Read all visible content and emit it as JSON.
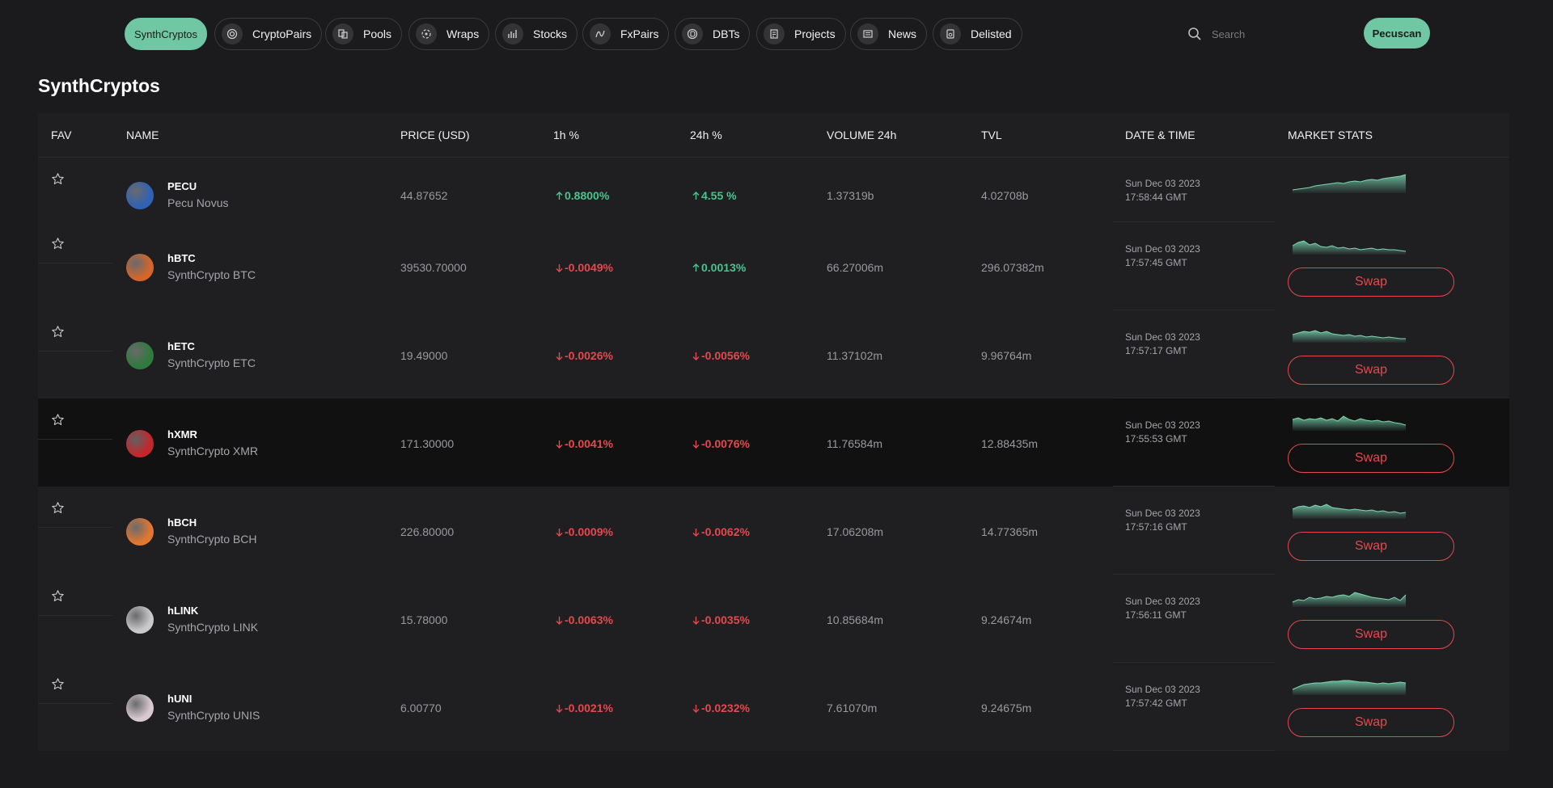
{
  "nav": {
    "tabs": [
      {
        "label": "SynthCryptos",
        "icon": "synthcryptos-icon",
        "active": true
      },
      {
        "label": "CryptoPairs",
        "icon": "coins-icon"
      },
      {
        "label": "Pools",
        "icon": "pools-icon"
      },
      {
        "label": "Wraps",
        "icon": "wraps-icon"
      },
      {
        "label": "Stocks",
        "icon": "stocks-chart-icon"
      },
      {
        "label": "FxPairs",
        "icon": "fxpairs-icon"
      },
      {
        "label": "DBTs",
        "icon": "dbts-icon"
      },
      {
        "label": "Projects",
        "icon": "projects-icon"
      },
      {
        "label": "News",
        "icon": "news-icon"
      },
      {
        "label": "Delisted",
        "icon": "delisted-icon"
      }
    ],
    "search_placeholder": "Search",
    "brand_button": "Pecuscan"
  },
  "page_title": "SynthCryptos",
  "table": {
    "headers": {
      "fav": "FAV",
      "name": "NAME",
      "price": "PRICE (USD)",
      "h1": "1h %",
      "h24": "24h %",
      "volume": "VOLUME 24h",
      "tvl": "TVL",
      "datetime": "DATE & TIME",
      "stats": "MARKET STATS"
    },
    "swap_label": "Swap",
    "rows": [
      {
        "symbol": "PECU",
        "name": "Pecu Novus",
        "price": "44.87652",
        "h1": "0.8800%",
        "h1_dir": "up",
        "h24": "4.55 %",
        "h24_dir": "up",
        "volume": "1.37319b",
        "tvl": "4.02708b",
        "date": "Sun Dec 03 2023",
        "time": "17:58:44 GMT",
        "coin_color": "#2f62b5",
        "swap": false
      },
      {
        "symbol": "hBTC",
        "name": "SynthCrypto BTC",
        "price": "39530.70000",
        "h1": "-0.0049%",
        "h1_dir": "down",
        "h24": "0.0013%",
        "h24_dir": "up",
        "volume": "66.27006m",
        "tvl": "296.07382m",
        "date": "Sun Dec 03 2023",
        "time": "17:57:45 GMT",
        "coin_color": "#d4662a",
        "swap": true
      },
      {
        "symbol": "hETC",
        "name": "SynthCrypto ETC",
        "price": "19.49000",
        "h1": "-0.0026%",
        "h1_dir": "down",
        "h24": "-0.0056%",
        "h24_dir": "down",
        "volume": "11.37102m",
        "tvl": "9.96764m",
        "date": "Sun Dec 03 2023",
        "time": "17:57:17 GMT",
        "coin_color": "#2f7a3c",
        "swap": true
      },
      {
        "symbol": "hXMR",
        "name": "SynthCrypto XMR",
        "price": "171.30000",
        "h1": "-0.0041%",
        "h1_dir": "down",
        "h24": "-0.0076%",
        "h24_dir": "down",
        "volume": "11.76584m",
        "tvl": "12.88435m",
        "date": "Sun Dec 03 2023",
        "time": "17:55:53 GMT",
        "coin_color": "#c4262b",
        "swap": true
      },
      {
        "symbol": "hBCH",
        "name": "SynthCrypto BCH",
        "price": "226.80000",
        "h1": "-0.0009%",
        "h1_dir": "down",
        "h24": "-0.0062%",
        "h24_dir": "down",
        "volume": "17.06208m",
        "tvl": "14.77365m",
        "date": "Sun Dec 03 2023",
        "time": "17:57:16 GMT",
        "coin_color": "#e2772f",
        "swap": true
      },
      {
        "symbol": "hLINK",
        "name": "SynthCrypto LINK",
        "price": "15.78000",
        "h1": "-0.0063%",
        "h1_dir": "down",
        "h24": "-0.0035%",
        "h24_dir": "down",
        "volume": "10.85684m",
        "tvl": "9.24674m",
        "date": "Sun Dec 03 2023",
        "time": "17:56:11 GMT",
        "coin_color": "#c9c9cc",
        "swap": true
      },
      {
        "symbol": "hUNI",
        "name": "SynthCrypto UNIS",
        "price": "6.00770",
        "h1": "-0.0021%",
        "h1_dir": "down",
        "h24": "-0.0232%",
        "h24_dir": "down",
        "volume": "7.61070m",
        "tvl": "9.24675m",
        "date": "Sun Dec 03 2023",
        "time": "17:57:42 GMT",
        "coin_color": "#d8c8d0",
        "swap": true
      }
    ]
  },
  "colors": {
    "accent": "#6fc7a3",
    "up": "#47c58d",
    "down": "#e5484d",
    "background": "#1b1b1d"
  }
}
